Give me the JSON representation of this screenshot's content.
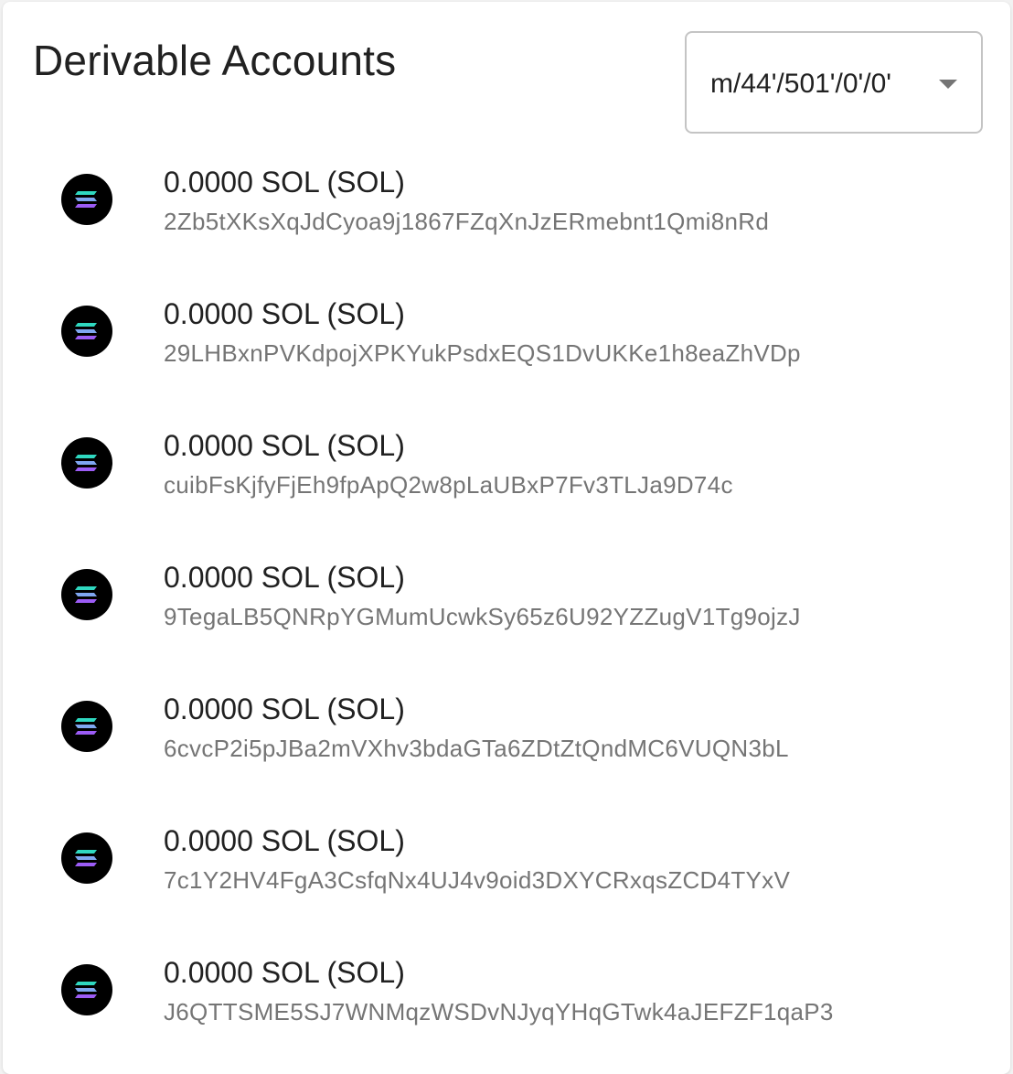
{
  "header": {
    "title": "Derivable Accounts"
  },
  "derivation_path_select": {
    "selected": "m/44'/501'/0'/0'"
  },
  "accounts": [
    {
      "balance": "0.0000 SOL (SOL)",
      "address": "2Zb5tXKsXqJdCyoa9j1867FZqXnJzERmebnt1Qmi8nRd",
      "icon": "solana-icon"
    },
    {
      "balance": "0.0000 SOL (SOL)",
      "address": "29LHBxnPVKdpojXPKYukPsdxEQS1DvUKKe1h8eaZhVDp",
      "icon": "solana-icon"
    },
    {
      "balance": "0.0000 SOL (SOL)",
      "address": "cuibFsKjfyFjEh9fpApQ2w8pLaUBxP7Fv3TLJa9D74c",
      "icon": "solana-icon"
    },
    {
      "balance": "0.0000 SOL (SOL)",
      "address": "9TegaLB5QNRpYGMumUcwkSy65z6U92YZZugV1Tg9ojzJ",
      "icon": "solana-icon"
    },
    {
      "balance": "0.0000 SOL (SOL)",
      "address": "6cvcP2i5pJBa2mVXhv3bdaGTa6ZDtZtQndMC6VUQN3bL",
      "icon": "solana-icon"
    },
    {
      "balance": "0.0000 SOL (SOL)",
      "address": "7c1Y2HV4FgA3CsfqNx4UJ4v9oid3DXYCRxqsZCD4TYxV",
      "icon": "solana-icon"
    },
    {
      "balance": "0.0000 SOL (SOL)",
      "address": "J6QTTSME5SJ7WNMqzWSDvNJyqYHqGTwk4aJEFZF1qaP3",
      "icon": "solana-icon"
    }
  ],
  "colors": {
    "solana_gradient_start": "#14F195",
    "solana_gradient_mid": "#80ECFF",
    "solana_gradient_end": "#9945FF",
    "icon_background": "#000000"
  }
}
